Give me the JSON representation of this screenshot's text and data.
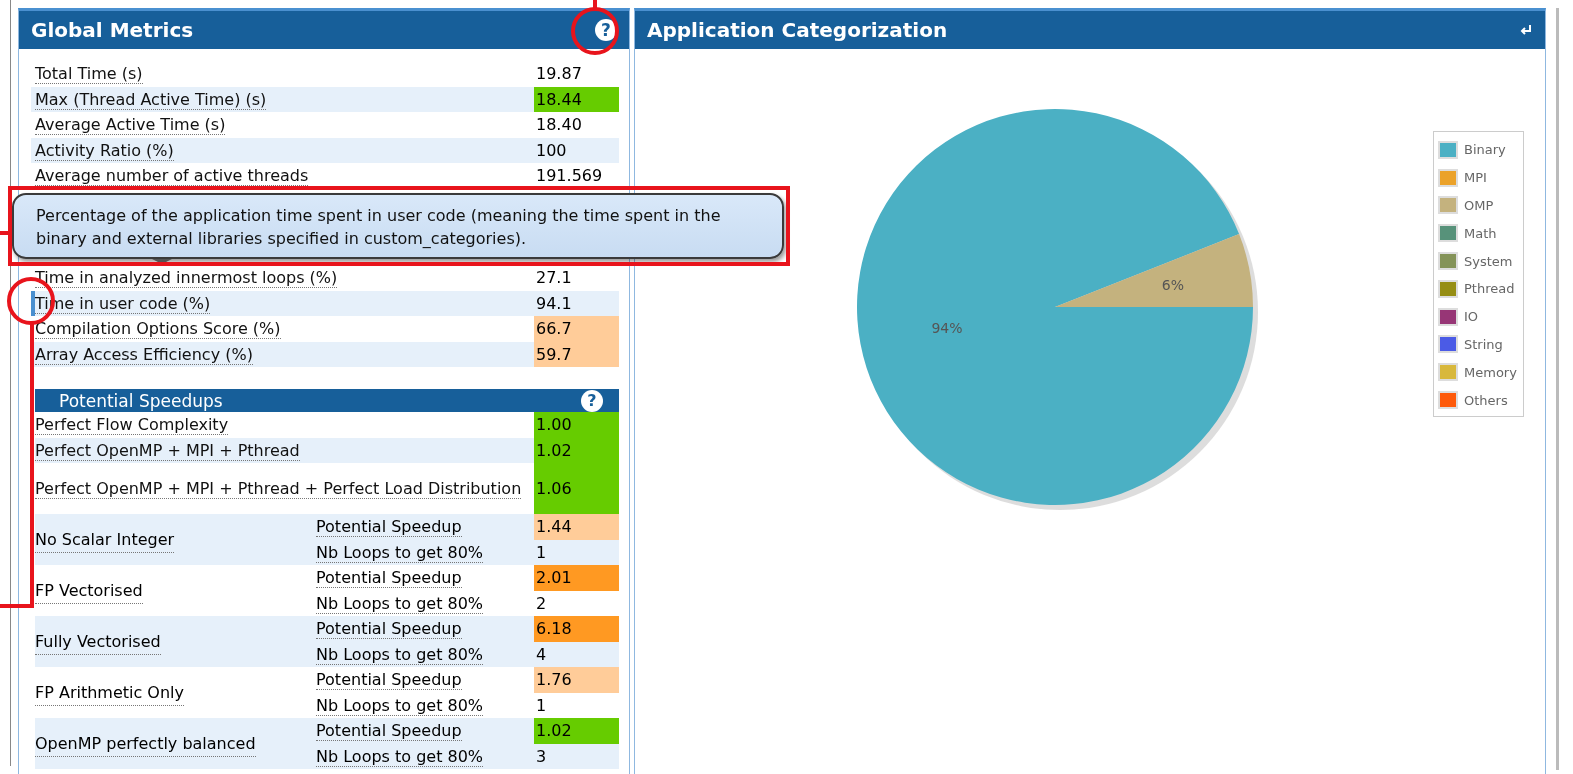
{
  "global_metrics": {
    "title": "Global Metrics",
    "help_icon": "?",
    "rows": [
      {
        "label": "Total Time (s)",
        "value": "19.87",
        "focused": false
      },
      {
        "label": "Max (Thread Active Time) (s)",
        "value": "18.44",
        "color": "#66cc00",
        "focused": false
      },
      {
        "label": "Average Active Time (s)",
        "value": "18.40",
        "focused": false
      },
      {
        "label": "Activity Ratio (%)",
        "value": "100",
        "focused": false
      },
      {
        "label": "Average number of active threads",
        "value": "191.569",
        "focused": false
      }
    ],
    "rows_after_tooltip": [
      {
        "label": "Time in analyzed innermost loops (%)",
        "value": "27.1",
        "focused": false
      },
      {
        "label": "Time in user code (%)",
        "value": "94.1",
        "focused": true
      },
      {
        "label": "Compilation Options Score (%)",
        "value": "66.7",
        "color": "#ffcc99",
        "focused": false
      },
      {
        "label": "Array Access Efficiency (%)",
        "value": "59.7",
        "color": "#ffcc99",
        "focused": false
      }
    ],
    "tooltip": "Percentage of the application time spent in user code (meaning the time spent in the binary and external libraries specified in custom_categories).",
    "speedups": {
      "title": "Potential Speedups",
      "help_icon": "?",
      "rows": [
        {
          "label": "Perfect Flow Complexity",
          "value": "1.00",
          "color": "#66cc00"
        },
        {
          "label": "Perfect OpenMP + MPI + Pthread",
          "value": "1.02",
          "color": "#66cc00"
        },
        {
          "label": "Perfect OpenMP + MPI + Pthread + Perfect Load Distribution",
          "value": "1.06",
          "color": "#66cc00"
        }
      ],
      "groups": [
        {
          "label": "No Scalar Integer",
          "speedup_label": "Potential Speedup",
          "speedup": "1.44",
          "color": "#ffcc99",
          "loops_label": "Nb Loops to get 80%",
          "loops": "1"
        },
        {
          "label": "FP Vectorised",
          "speedup_label": "Potential Speedup",
          "speedup": "2.01",
          "color": "#ff9922",
          "loops_label": "Nb Loops to get 80%",
          "loops": "2"
        },
        {
          "label": "Fully Vectorised",
          "speedup_label": "Potential Speedup",
          "speedup": "6.18",
          "color": "#ff9922",
          "loops_label": "Nb Loops to get 80%",
          "loops": "4"
        },
        {
          "label": "FP Arithmetic Only",
          "speedup_label": "Potential Speedup",
          "speedup": "1.76",
          "color": "#ffcc99",
          "loops_label": "Nb Loops to get 80%",
          "loops": "1"
        },
        {
          "label": "OpenMP perfectly balanced",
          "speedup_label": "Potential Speedup",
          "speedup": "1.02",
          "color": "#66cc00",
          "loops_label": "Nb Loops to get 80%",
          "loops": "3"
        }
      ]
    }
  },
  "application_categorization": {
    "title": "Application Categorization",
    "chart_data": {
      "type": "pie",
      "categories": [
        "Binary",
        "MPI",
        "OMP",
        "Math",
        "System",
        "Pthread",
        "IO",
        "String",
        "Memory",
        "Others"
      ],
      "values": [
        94,
        0,
        6,
        0,
        0,
        0,
        0,
        0,
        0,
        0
      ],
      "value_labels": [
        "94%",
        null,
        "6%",
        null,
        null,
        null,
        null,
        null,
        null,
        null
      ],
      "colors": [
        "#4bb0c4",
        "#eba22a",
        "#c4b27e",
        "#57927a",
        "#849358",
        "#968e14",
        "#973676",
        "#4b5be6",
        "#d8b83c",
        "#fe5a0a"
      ]
    }
  }
}
